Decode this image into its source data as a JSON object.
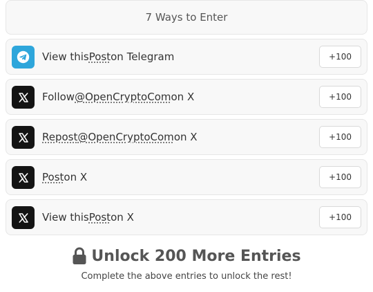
{
  "header": {
    "title": "7 Ways to Enter"
  },
  "entries": [
    {
      "icon": "telegram-icon",
      "pre": "View this ",
      "link": "Post",
      "post": " on Telegram",
      "points": "+100"
    },
    {
      "icon": "x-icon",
      "pre": "Follow ",
      "link": "@OpenCryptoCom",
      "post": " on X",
      "points": "+100"
    },
    {
      "icon": "x-icon",
      "pre": "",
      "link": "Repost",
      "mid": " ",
      "link2": "@OpenCryptoCom",
      "post": " on X",
      "points": "+100"
    },
    {
      "icon": "x-icon",
      "pre": "",
      "link": "Post",
      "post": " on X",
      "points": "+100"
    },
    {
      "icon": "x-icon",
      "pre": "View this ",
      "link": "Post",
      "post": " on X",
      "points": "+100"
    }
  ],
  "unlock": {
    "icon": "lock-icon",
    "title": "Unlock 200 More Entries",
    "subtitle": "Complete the above entries to unlock the rest!"
  },
  "colors": {
    "telegram": "#2ea6db",
    "x": "#141414",
    "card_bg": "#f8f8f8",
    "border": "#e6e6e6"
  }
}
